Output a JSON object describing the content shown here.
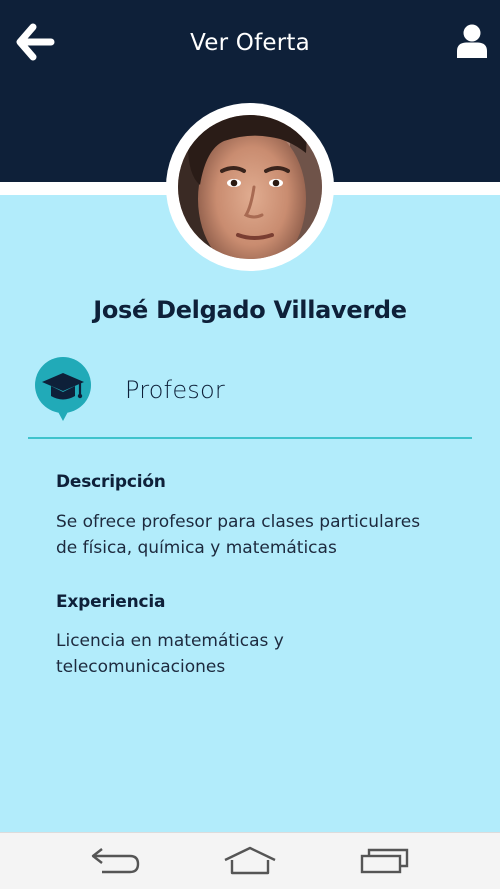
{
  "header": {
    "title": "Ver Oferta",
    "back_icon": "arrow-left-icon",
    "profile_icon": "user-icon"
  },
  "profile": {
    "name": "José Delgado Villaverde",
    "avatar_alt": "José Delgado Villaverde"
  },
  "offer": {
    "category": "Profesor",
    "category_icon": "graduation-cap-icon",
    "description_heading": "Descripción",
    "description_text": "Se ofrece profesor para clases particulares\nde física, química y matemáticas",
    "experience_heading": "Experiencia",
    "experience_text": "Licencia en matemáticas y\ntelecomunicaciones"
  },
  "navbar": {
    "back_icon": "nav-back-icon",
    "home_icon": "nav-home-icon",
    "recents_icon": "nav-recents-icon"
  },
  "colors": {
    "header_bg": "#0e2039",
    "content_bg": "#b2ecfb",
    "accent": "#3fc3cc",
    "icon_teal": "#21aab8",
    "navbar_bg": "#f4f4f4"
  }
}
